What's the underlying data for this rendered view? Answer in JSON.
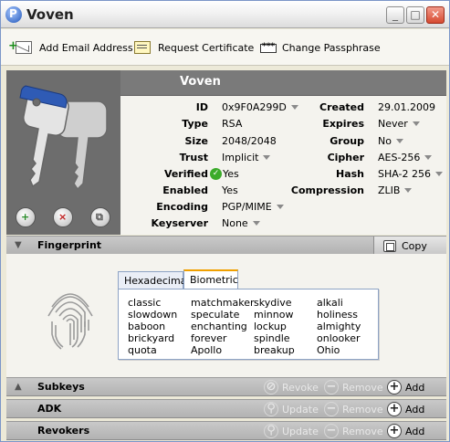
{
  "window": {
    "title": "Voven",
    "minimize": "_",
    "maximize": "□",
    "close": "✕"
  },
  "toolbar": [
    {
      "label": "Add Email Address",
      "icon": "add-email-icon"
    },
    {
      "label": "Request Certificate",
      "icon": "certificate-icon"
    },
    {
      "label": "Change Passphrase",
      "icon": "passphrase-icon"
    }
  ],
  "key": {
    "name": "Voven"
  },
  "properties_left": [
    {
      "label": "ID",
      "value": "0x9F0A299D",
      "dropdown": true
    },
    {
      "label": "Type",
      "value": "RSA",
      "dropdown": false
    },
    {
      "label": "Size",
      "value": "2048/2048",
      "dropdown": false
    },
    {
      "label": "Trust",
      "value": "Implicit",
      "dropdown": true
    },
    {
      "label": "Verified",
      "value": "Yes",
      "dropdown": false,
      "check": true
    },
    {
      "label": "Enabled",
      "value": "Yes",
      "dropdown": false
    },
    {
      "label": "Encoding",
      "value": "PGP/MIME",
      "dropdown": true
    },
    {
      "label": "Keyserver",
      "value": "None",
      "dropdown": true
    }
  ],
  "properties_right": [
    {
      "label": "Created",
      "value": "29.01.2009",
      "dropdown": false
    },
    {
      "label": "Expires",
      "value": "Never",
      "dropdown": true
    },
    {
      "label": "Group",
      "value": "No",
      "dropdown": true
    },
    {
      "label": "Cipher",
      "value": "AES-256",
      "dropdown": true
    },
    {
      "label": "Hash",
      "value": "SHA-2 256",
      "dropdown": true
    },
    {
      "label": "Compression",
      "value": "ZLIB",
      "dropdown": true
    }
  ],
  "sections": {
    "fingerprint": {
      "title": "Fingerprint",
      "copy_label": "Copy"
    },
    "subkeys": {
      "title": "Subkeys",
      "revoke": "Revoke",
      "remove": "Remove",
      "add": "Add"
    },
    "adk": {
      "title": "ADK",
      "update": "Update",
      "remove": "Remove",
      "add": "Add"
    },
    "revokers": {
      "title": "Revokers",
      "update": "Update",
      "remove": "Remove",
      "add": "Add"
    }
  },
  "fingerprint": {
    "tabs": [
      "Hexadecimal",
      "Biometric"
    ],
    "active_tab": "Biometric",
    "words": [
      [
        "classic",
        "slowdown",
        "baboon",
        "brickyard",
        "quota"
      ],
      [
        "matchmaker",
        "speculate",
        "enchanting",
        "forever",
        "Apollo"
      ],
      [
        "skydive",
        "minnow",
        "lockup",
        "spindle",
        "breakup"
      ],
      [
        "alkali",
        "holiness",
        "almighty",
        "onlooker",
        "Ohio"
      ]
    ]
  },
  "colors": {
    "verified": "#3bab2a",
    "accent_tab": "#f0a000",
    "panel_gray": "#7a7a7a"
  }
}
